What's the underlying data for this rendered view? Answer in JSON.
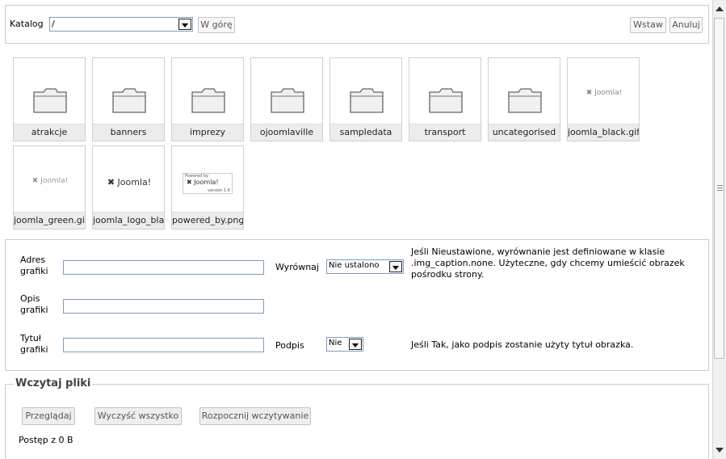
{
  "toolbar": {
    "katalog_label": "Katalog",
    "katalog_value": "/",
    "up_label": "W górę",
    "insert_label": "Wstaw",
    "cancel_label": "Anuluj"
  },
  "thumbnails": [
    {
      "label": "atrakcje",
      "type": "folder"
    },
    {
      "label": "banners",
      "type": "folder"
    },
    {
      "label": "imprezy",
      "type": "folder"
    },
    {
      "label": "ojoomlaville",
      "type": "folder"
    },
    {
      "label": "sampledata",
      "type": "folder"
    },
    {
      "label": "transport",
      "type": "folder"
    },
    {
      "label": "uncategorised",
      "type": "folder"
    },
    {
      "label": "joomla_black.gif",
      "type": "image",
      "logo_text": "Joomla!"
    },
    {
      "label": "joomla_green.gif",
      "type": "image",
      "logo_text": "Joomla!"
    },
    {
      "label": "joomla_logo_blac",
      "type": "image",
      "logo_text": "Joomla!"
    },
    {
      "label": "powered_by.png",
      "type": "image",
      "logo_text": "Joomla!",
      "small_top": "Powered by",
      "small_bottom": "version 1.6"
    }
  ],
  "form": {
    "url_label": "Adres grafiki",
    "url_value": "",
    "align_label": "Wyrównaj",
    "align_value": "Nie ustalono",
    "align_note": "Jeśli Nieustawione, wyrównanie jest definiowane w klasie .img_caption.none. Użyteczne, gdy chcemy umieścić obrazek pośrodku strony.",
    "desc_label": "Opis grafiki",
    "desc_value": "",
    "title_label": "Tytuł grafiki",
    "title_value": "",
    "caption_label": "Podpis",
    "caption_value": "Nie",
    "caption_note": "Jeśli Tak, jako podpis zostanie użyty tytuł obrazka."
  },
  "upload": {
    "legend": "Wczytaj pliki",
    "browse_label": "Przeglądaj",
    "clear_label": "Wyczyść wszystko",
    "start_label": "Rozpocznij wczytywanie",
    "progress_text": "Postęp z 0 B"
  },
  "colors": {
    "border": "#cccccc",
    "input_border": "#7f9db9",
    "caption_bg": "#ececec"
  }
}
